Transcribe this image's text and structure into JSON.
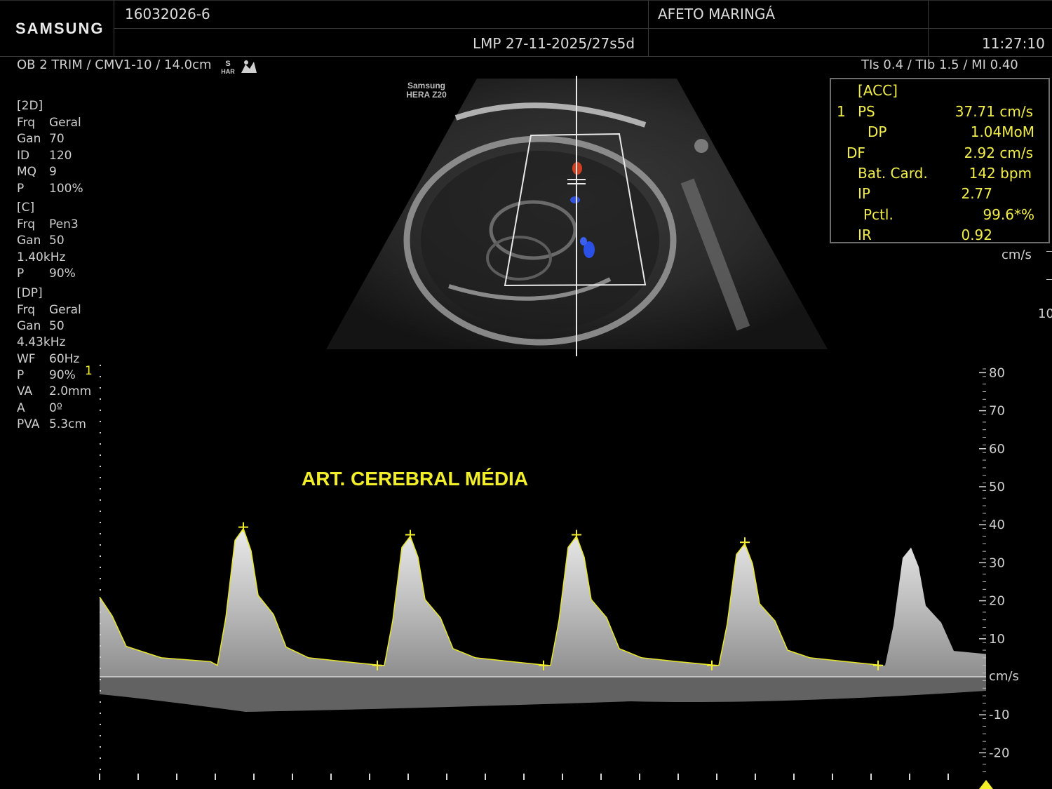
{
  "header": {
    "brand": "SAMSUNG",
    "patient_id": "16032026-6",
    "institution": "AFETO MARINGÁ",
    "lmp": "LMP 27-11-2025/27s5d",
    "time": "11:27:10"
  },
  "status": {
    "exam": "OB 2 TRIM / CMV1-10 / 14.0cm",
    "har_top": "S",
    "har_bottom": "HAR",
    "thermal": "TIs  0.4 / TIb  1.5 / MI  0.40"
  },
  "image_watermark": {
    "line1": "Samsung",
    "line2": "HERA Z20"
  },
  "params": {
    "twod": {
      "header": "[2D]",
      "rows": [
        {
          "k": "Frq",
          "v": "Geral"
        },
        {
          "k": "Gan",
          "v": "70"
        },
        {
          "k": "ID",
          "v": "120"
        },
        {
          "k": "MQ",
          "v": "9"
        },
        {
          "k": "P",
          "v": "100%"
        }
      ]
    },
    "color": {
      "header": "[C]",
      "rows": [
        {
          "k": "Frq",
          "v": "Pen3"
        },
        {
          "k": "Gan",
          "v": "50"
        },
        {
          "k": "",
          "v": "1.40kHz"
        },
        {
          "k": "P",
          "v": "90%"
        }
      ]
    },
    "dp": {
      "header": "[DP]",
      "rows": [
        {
          "k": "Frq",
          "v": "Geral"
        },
        {
          "k": "Gan",
          "v": "50"
        },
        {
          "k": "",
          "v": "4.43kHz"
        },
        {
          "k": "WF",
          "v": "60Hz"
        },
        {
          "k": "P",
          "v": "90%"
        },
        {
          "k": "VA",
          "v": "2.0mm"
        },
        {
          "k": "A",
          "v": "0º"
        },
        {
          "k": "PVA",
          "v": "5.3cm"
        }
      ]
    }
  },
  "measurements": {
    "header": "[ACC]",
    "index": "1",
    "rows": [
      {
        "label": "PS",
        "value": "37.71  cm/s"
      },
      {
        "label": "DP",
        "value": "1.04MoM"
      },
      {
        "label": "DF",
        "value": "2.92  cm/s"
      },
      {
        "label": "Bat. Card.",
        "value": "142  bpm"
      },
      {
        "label": "IP",
        "value": "2.77"
      },
      {
        "label": "Pctl.",
        "value": "99.6*%"
      },
      {
        "label": "IR",
        "value": "0.92"
      }
    ]
  },
  "color_scale": {
    "unit": "cm/s",
    "max": "10"
  },
  "spectrum": {
    "label": "ART. CEREBRAL MÉDIA",
    "gate_marker": "1",
    "unit": "cm/s",
    "ticks": [
      "80",
      "70",
      "60",
      "50",
      "40",
      "30",
      "20",
      "10",
      "-10",
      "-20"
    ],
    "peak_velocities_cm_s": [
      39,
      37,
      37,
      35,
      34
    ]
  }
}
